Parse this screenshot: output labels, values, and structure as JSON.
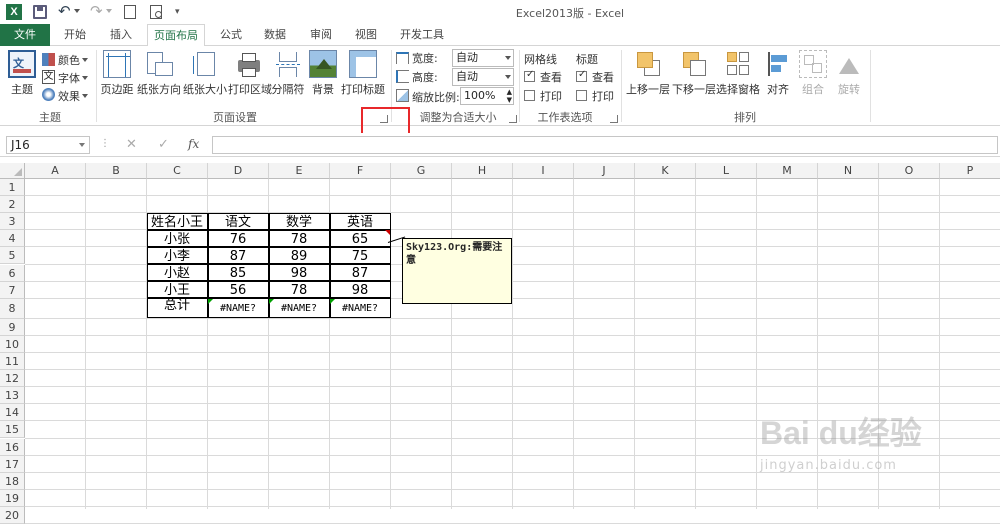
{
  "window": {
    "title": "Excel2013版 - Excel"
  },
  "quick_access": {
    "icons": [
      "excel-logo",
      "save",
      "undo",
      "redo",
      "new",
      "preview",
      "customize"
    ]
  },
  "tabs": [
    {
      "label": "文件",
      "active": false,
      "file": true
    },
    {
      "label": "开始",
      "active": false
    },
    {
      "label": "插入",
      "active": false
    },
    {
      "label": "页面布局",
      "active": true
    },
    {
      "label": "公式",
      "active": false
    },
    {
      "label": "数据",
      "active": false
    },
    {
      "label": "审阅",
      "active": false
    },
    {
      "label": "视图",
      "active": false
    },
    {
      "label": "开发工具",
      "active": false
    }
  ],
  "ribbon": {
    "themes": {
      "theme_label": "主题",
      "colors_label": "颜色",
      "fonts_label": "字体",
      "effects_label": "效果",
      "group_label": "主题"
    },
    "page_setup": {
      "buttons": [
        "页边距",
        "纸张方向",
        "纸张大小",
        "打印区域",
        "分隔符",
        "背景",
        "打印标题"
      ],
      "group_label": "页面设置"
    },
    "scale_to_fit": {
      "width_label": "宽度:",
      "width_value": "自动",
      "height_label": "高度:",
      "height_value": "自动",
      "scale_label": "缩放比例:",
      "scale_value": "100%",
      "group_label": "调整为合适大小"
    },
    "sheet_options": {
      "gridlines_label": "网格线",
      "headings_label": "标题",
      "view_label": "查看",
      "print_label": "打印",
      "gridlines_view": true,
      "gridlines_print": false,
      "headings_view": true,
      "headings_print": false,
      "group_label": "工作表选项"
    },
    "arrange": {
      "buttons": [
        "上移一层",
        "下移一层",
        "选择窗格",
        "对齐",
        "组合",
        "旋转"
      ],
      "group_label": "排列"
    }
  },
  "formula_bar": {
    "name_box": "J16",
    "fx": "fx",
    "formula": ""
  },
  "columns": [
    "A",
    "B",
    "C",
    "D",
    "E",
    "F",
    "G",
    "H",
    "I",
    "J",
    "K",
    "L",
    "M",
    "N",
    "O",
    "P"
  ],
  "rows": [
    "1",
    "2",
    "3",
    "4",
    "5",
    "6",
    "7",
    "8",
    "9",
    "10",
    "11",
    "12",
    "13",
    "14",
    "15",
    "16",
    "17",
    "18",
    "19",
    "20"
  ],
  "table": {
    "header": [
      "姓名小王",
      "语文",
      "数学",
      "英语"
    ],
    "rows": [
      [
        "小张",
        "76",
        "78",
        "65"
      ],
      [
        "小李",
        "87",
        "89",
        "75"
      ],
      [
        "小赵",
        "85",
        "98",
        "87"
      ],
      [
        "小王",
        "56",
        "78",
        "98"
      ],
      [
        "总计",
        "#NAME?",
        "#NAME?",
        "#NAME?"
      ]
    ]
  },
  "comment": {
    "text": "Sky123.Org:需要注意"
  },
  "watermark": {
    "brand": "Bai du经验",
    "url": "jingyan.baidu.com"
  },
  "colors": {
    "excel_green": "#217346",
    "highlight_red": "#e8282b",
    "comment_bg": "#ffffe1",
    "error_triangle": "#00a000",
    "comment_marker": "#cc0000"
  }
}
